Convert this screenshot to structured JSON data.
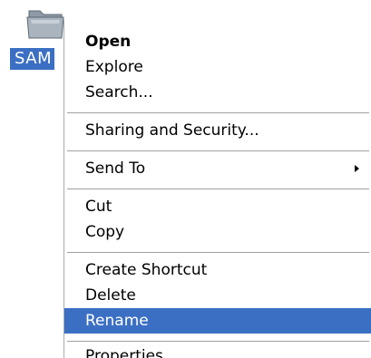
{
  "desktop": {
    "file_label": "SAM",
    "folder_icon": "folder-icon",
    "colors": {
      "selection": "#3b6fc4",
      "menu_border": "#a9a9a9"
    }
  },
  "context_menu": {
    "items": [
      {
        "label": "Open",
        "bold": true
      },
      {
        "label": "Explore"
      },
      {
        "label": "Search..."
      },
      {
        "label": "Sharing and Security..."
      },
      {
        "label": "Send To",
        "submenu": true
      },
      {
        "label": "Cut"
      },
      {
        "label": "Copy"
      },
      {
        "label": "Create Shortcut"
      },
      {
        "label": "Delete"
      },
      {
        "label": "Rename",
        "selected": true
      },
      {
        "label": "Properties"
      }
    ],
    "submenu_icon": "chevron-right-icon"
  }
}
